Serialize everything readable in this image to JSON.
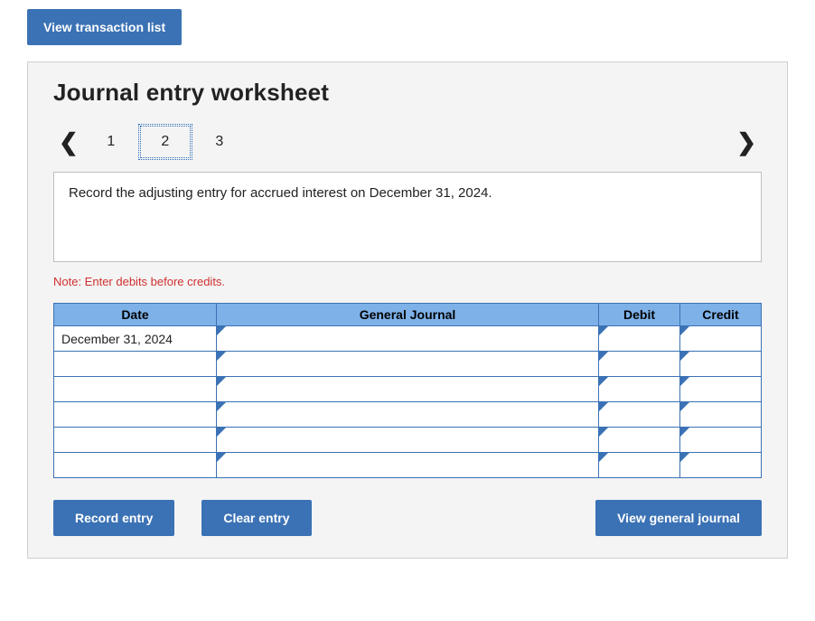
{
  "top": {
    "view_transaction_list": "View transaction list"
  },
  "worksheet": {
    "title": "Journal entry worksheet",
    "nav": {
      "prev_glyph": "❮",
      "next_glyph": "❯",
      "items": [
        "1",
        "2",
        "3"
      ],
      "active_index": 1
    },
    "instruction": "Record the adjusting entry for accrued interest on December 31, 2024.",
    "note": "Note: Enter debits before credits.",
    "table": {
      "headers": {
        "date": "Date",
        "general_journal": "General Journal",
        "debit": "Debit",
        "credit": "Credit"
      },
      "rows": [
        {
          "date": "December 31, 2024",
          "gj": "",
          "debit": "",
          "credit": ""
        },
        {
          "date": "",
          "gj": "",
          "debit": "",
          "credit": ""
        },
        {
          "date": "",
          "gj": "",
          "debit": "",
          "credit": ""
        },
        {
          "date": "",
          "gj": "",
          "debit": "",
          "credit": ""
        },
        {
          "date": "",
          "gj": "",
          "debit": "",
          "credit": ""
        },
        {
          "date": "",
          "gj": "",
          "debit": "",
          "credit": ""
        }
      ]
    },
    "buttons": {
      "record": "Record entry",
      "clear": "Clear entry",
      "view_journal": "View general journal"
    }
  }
}
